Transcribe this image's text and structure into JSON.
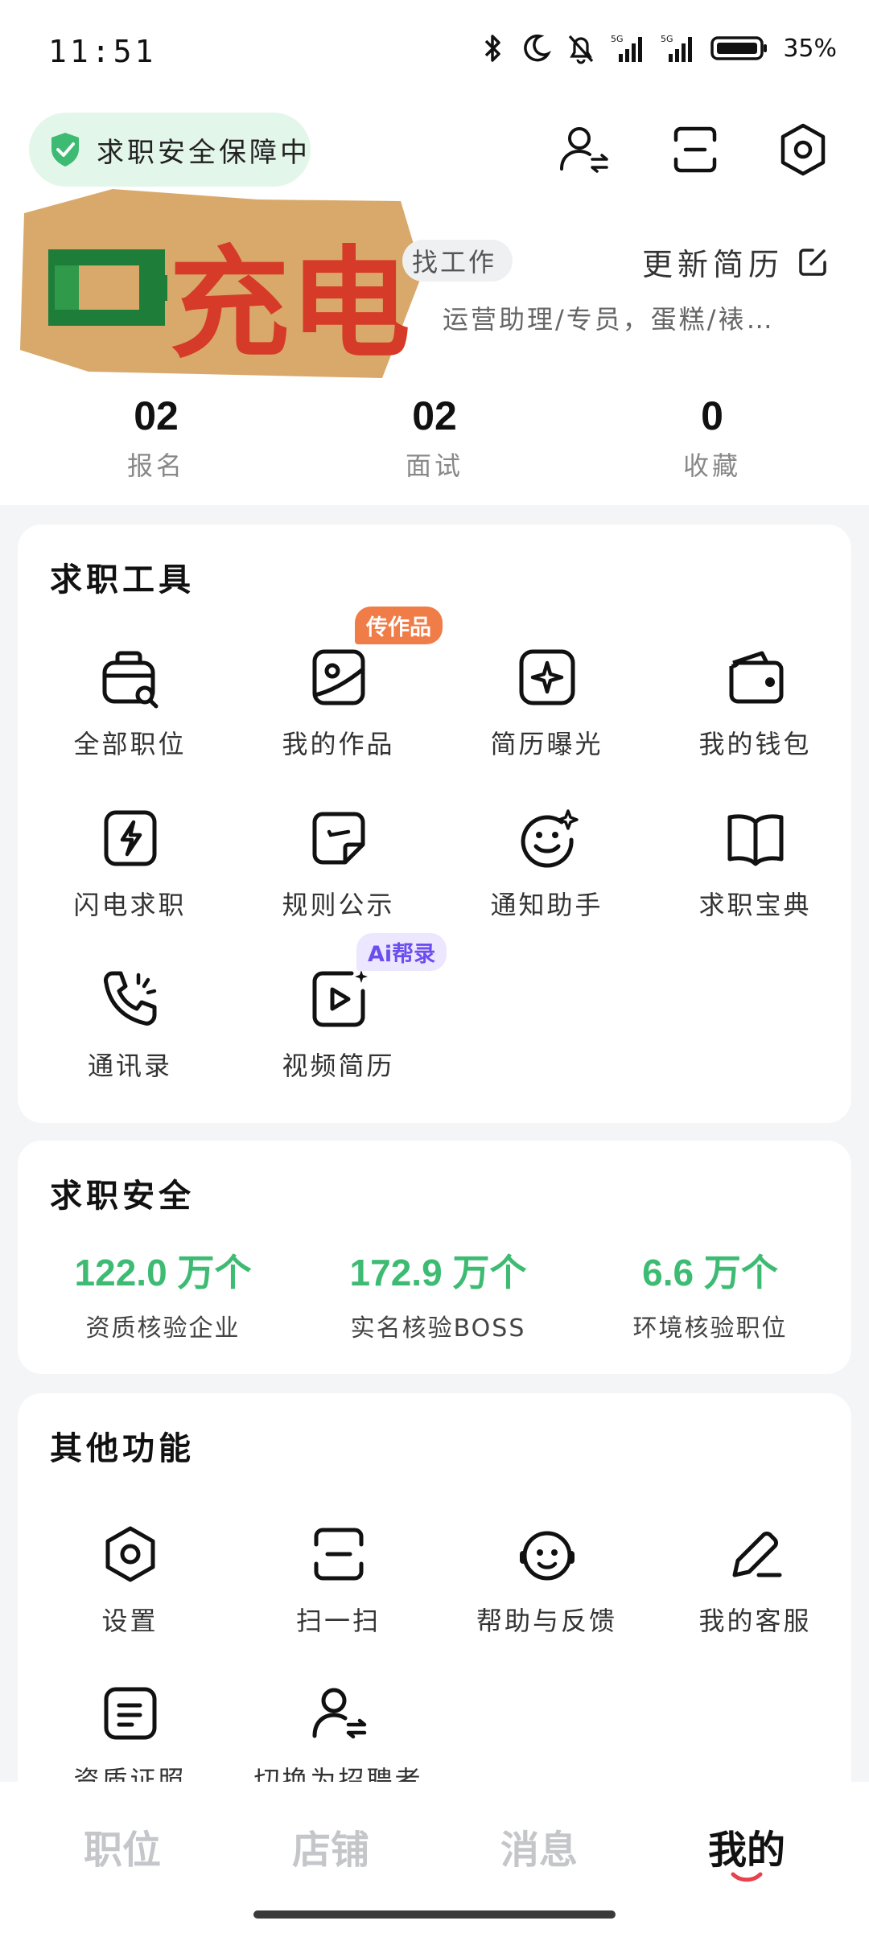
{
  "status_bar": {
    "time": "11:51",
    "battery": "35%",
    "network_1": "5G",
    "network_2": "5G"
  },
  "header": {
    "safety_pill": "求职安全保障中",
    "icons": [
      "switch-role-icon",
      "scan-icon",
      "settings-icon"
    ]
  },
  "profile": {
    "sticker_text": "充电",
    "status": "找工作",
    "update_resume": "更新简历",
    "intent": "运营助理/专员，蛋糕/裱…"
  },
  "stats": [
    {
      "num": "02",
      "label": "报名"
    },
    {
      "num": "02",
      "label": "面试"
    },
    {
      "num": "0",
      "label": "收藏"
    }
  ],
  "tools": {
    "title": "求职工具",
    "items": [
      {
        "label": "全部职位",
        "icon": "job-search-icon"
      },
      {
        "label": "我的作品",
        "icon": "portfolio-icon",
        "tag": "传作品"
      },
      {
        "label": "简历曝光",
        "icon": "resume-boost-icon"
      },
      {
        "label": "我的钱包",
        "icon": "wallet-icon"
      },
      {
        "label": "闪电求职",
        "icon": "lightning-icon"
      },
      {
        "label": "规则公示",
        "icon": "rules-icon"
      },
      {
        "label": "通知助手",
        "icon": "notify-assistant-icon"
      },
      {
        "label": "求职宝典",
        "icon": "book-icon"
      },
      {
        "label": "通讯录",
        "icon": "phone-contacts-icon"
      },
      {
        "label": "视频简历",
        "icon": "video-resume-icon",
        "tag": "Ai帮录"
      }
    ]
  },
  "safety": {
    "title": "求职安全",
    "items": [
      {
        "value": "122.0 万个",
        "label": "资质核验企业"
      },
      {
        "value": "172.9 万个",
        "label": "实名核验BOSS"
      },
      {
        "value": "6.6 万个",
        "label": "环境核验职位"
      }
    ],
    "accent": "#3dbb73"
  },
  "other": {
    "title": "其他功能",
    "items": [
      {
        "label": "设置",
        "icon": "settings-icon"
      },
      {
        "label": "扫一扫",
        "icon": "scan-icon"
      },
      {
        "label": "帮助与反馈",
        "icon": "help-feedback-icon"
      },
      {
        "label": "我的客服",
        "icon": "customer-service-icon"
      },
      {
        "label": "资质证照",
        "icon": "license-icon"
      },
      {
        "label": "切换为招聘者",
        "icon": "switch-role-icon"
      }
    ]
  },
  "tabbar": {
    "tabs": [
      "职位",
      "店铺",
      "消息",
      "我的"
    ],
    "active": "我的",
    "accent": "#e8414d"
  }
}
